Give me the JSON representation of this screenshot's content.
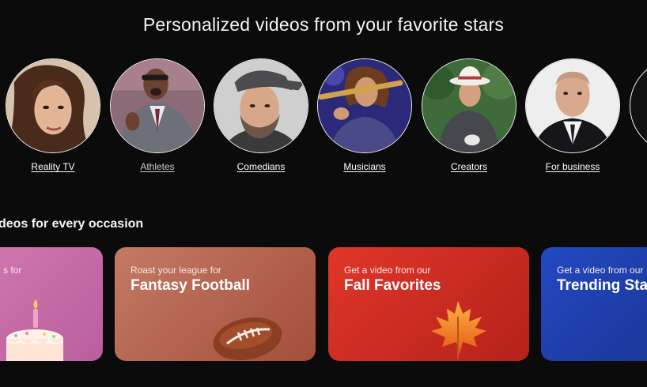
{
  "hero": {
    "headline": "Personalized videos from your favorite stars"
  },
  "categories": [
    {
      "label": "Reality TV"
    },
    {
      "label": "Athletes"
    },
    {
      "label": "Comedians"
    },
    {
      "label": "Musicians"
    },
    {
      "label": "Creators"
    },
    {
      "label": "For business"
    }
  ],
  "occasions": {
    "title": "deos for every occasion",
    "cards": [
      {
        "sub": "s for",
        "title": ""
      },
      {
        "sub": "Roast your league for",
        "title": "Fantasy Football"
      },
      {
        "sub": "Get a video from our",
        "title": "Fall Favorites"
      },
      {
        "sub": "Get a video from our",
        "title": "Trending Sta"
      }
    ]
  },
  "colors": {
    "background": "#0b0b0c",
    "card_birthday": "#c06aa8",
    "card_football": "#b4614f",
    "card_fall": "#c8291f",
    "card_trending": "#1f3fb0"
  }
}
